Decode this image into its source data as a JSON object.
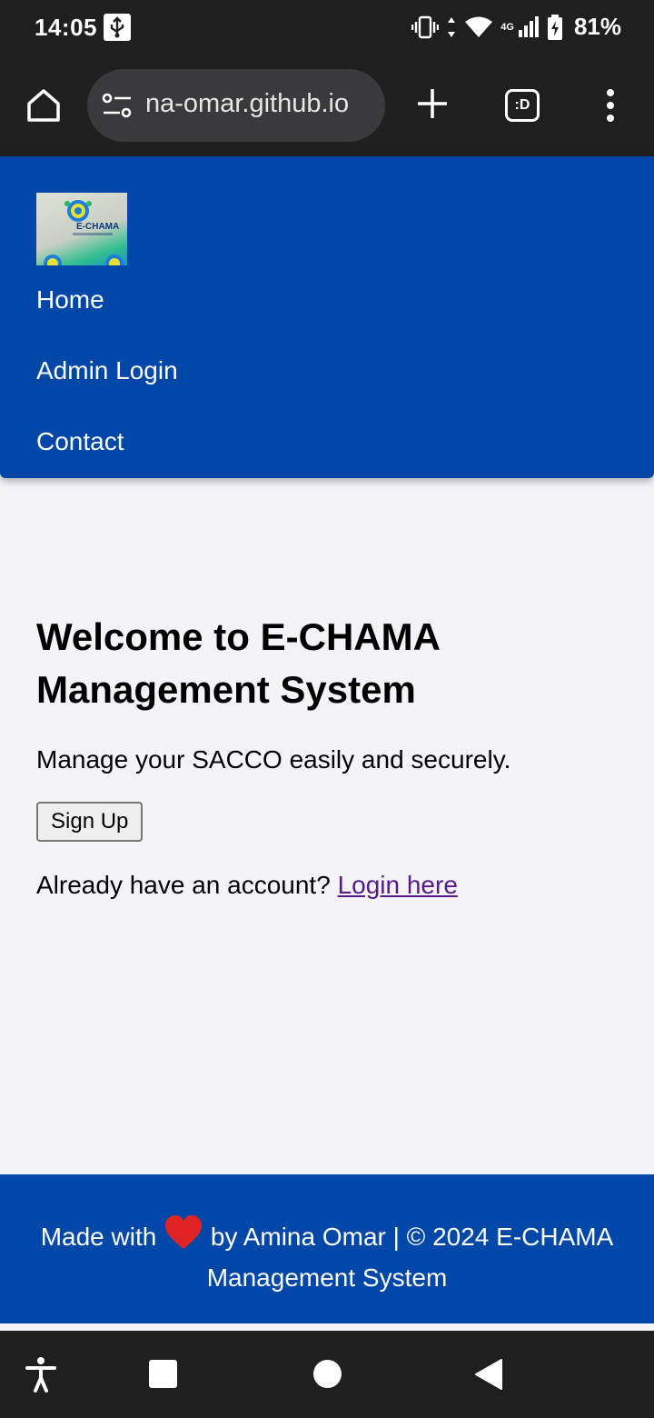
{
  "status_bar": {
    "time": "14:05",
    "battery": "81%",
    "network": "4G",
    "icons": [
      "usb-icon",
      "vibrate-icon",
      "wifi-icon",
      "signal-icon",
      "battery-charging-icon"
    ]
  },
  "browser": {
    "url": "na-omar.github.io",
    "tab_count": ":D",
    "icons": [
      "home-icon",
      "site-settings-icon",
      "new-tab-icon",
      "tabs-icon",
      "menu-icon"
    ]
  },
  "header": {
    "logo_text": "E-CHAMA",
    "nav": [
      {
        "label": "Home"
      },
      {
        "label": "Admin Login"
      },
      {
        "label": "Contact"
      }
    ]
  },
  "main": {
    "title": "Welcome to E-CHAMA Management System",
    "subtitle": "Manage your SACCO easily and securely.",
    "signup_label": "Sign Up",
    "login_prompt": "Already have an account?",
    "login_link": "Login here"
  },
  "footer": {
    "made_with": "Made with",
    "by_line": "by Amina Omar | © 2024 E-CHAMA Management System"
  },
  "colors": {
    "brand_blue": "#0047a8",
    "page_bg": "#f3f3f8",
    "link_visited": "#551a8b"
  }
}
